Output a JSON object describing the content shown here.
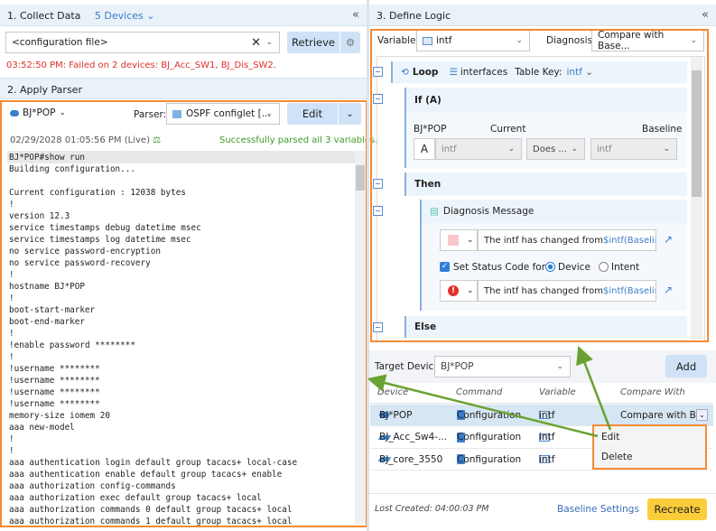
{
  "collect": {
    "title": "1. Collect Data",
    "devices": "5 Devices",
    "input": "<configuration file>",
    "retrieve": "Retrieve",
    "error": "03:52:50 PM: Failed on 2 devices: BJ_Acc_SW1, BJ_Dis_SW2."
  },
  "parser": {
    "title": "2. Apply Parser",
    "device": "BJ*POP",
    "label": "Parser:",
    "value": "OSPF configlet [...",
    "edit": "Edit",
    "timestamp": "02/29/2028 01:05:56 PM (Live)",
    "status": "Successfully parsed all 3 variables."
  },
  "code": [
    "BJ*POP#show run",
    "Building configuration...",
    "",
    "Current configuration : 12038 bytes",
    "!",
    "version 12.3",
    "service timestamps debug datetime msec",
    "service timestamps log datetime msec",
    "no service password-encryption",
    "no service password-recovery",
    "!",
    "hostname BJ*POP",
    "!",
    "boot-start-marker",
    "boot-end-marker",
    "!",
    "!enable password ********",
    "!",
    "!username ********",
    "!username ********",
    "!username ********",
    "!username ********",
    "memory-size iomem 20",
    "aaa new-model",
    "!",
    "!",
    "aaa authentication login default group tacacs+ local-case",
    "aaa authentication enable default group tacacs+ enable",
    "aaa authorization config-commands",
    "aaa authorization exec default group tacacs+ local",
    "aaa authorization commands 0 default group tacacs+ local",
    "aaa authorization commands 1 default group tacacs+ local"
  ],
  "logic": {
    "title": "3. Define Logic",
    "variable_label": "Variable:",
    "variable": "intf",
    "diagnosis_label": "Diagnosis:",
    "diagnosis": "Compare with Base...",
    "loop": "Loop",
    "table": "interfaces",
    "table_key_label": "Table Key:",
    "table_key": "intf",
    "if": "If (A)",
    "device": "BJ*POP",
    "current": "Current",
    "baseline": "Baseline",
    "a": "A",
    "cur_var": "intf",
    "op": "Does ...",
    "base_var": "intf",
    "then": "Then",
    "diag_msg": "Diagnosis Message",
    "msg_text": "The intf has changed from ",
    "msg_var": "$intf(Baseline)",
    "set_status": "Set Status Code for",
    "device_opt": "Device",
    "intent_opt": "Intent",
    "else": "Else"
  },
  "target": {
    "label": "Target Device:",
    "value": "BJ*POP",
    "add": "Add",
    "headers": [
      "Device",
      "Command",
      "Variable",
      "Compare With"
    ],
    "rows": [
      {
        "device": "BJ*POP",
        "command": "Configuration",
        "variable": "intf",
        "compare": "Compare with B..."
      },
      {
        "device": "BJ_Acc_Sw4-...",
        "command": "Configuration",
        "variable": "intf",
        "compare": ""
      },
      {
        "device": "BJ_core_3550",
        "command": "Configuration",
        "variable": "intf",
        "compare": ""
      }
    ],
    "menu": [
      "Edit",
      "Delete"
    ],
    "last_created": "Lost Created: 04:00:03 PM",
    "baseline_settings": "Baseline Settings",
    "recreate": "Recreate"
  },
  "colors": {
    "accent": "#f58a33",
    "arrow": "#6aa232",
    "error": "#e0302a",
    "success": "#3f9a2a",
    "recreate": "#fccd3a"
  }
}
